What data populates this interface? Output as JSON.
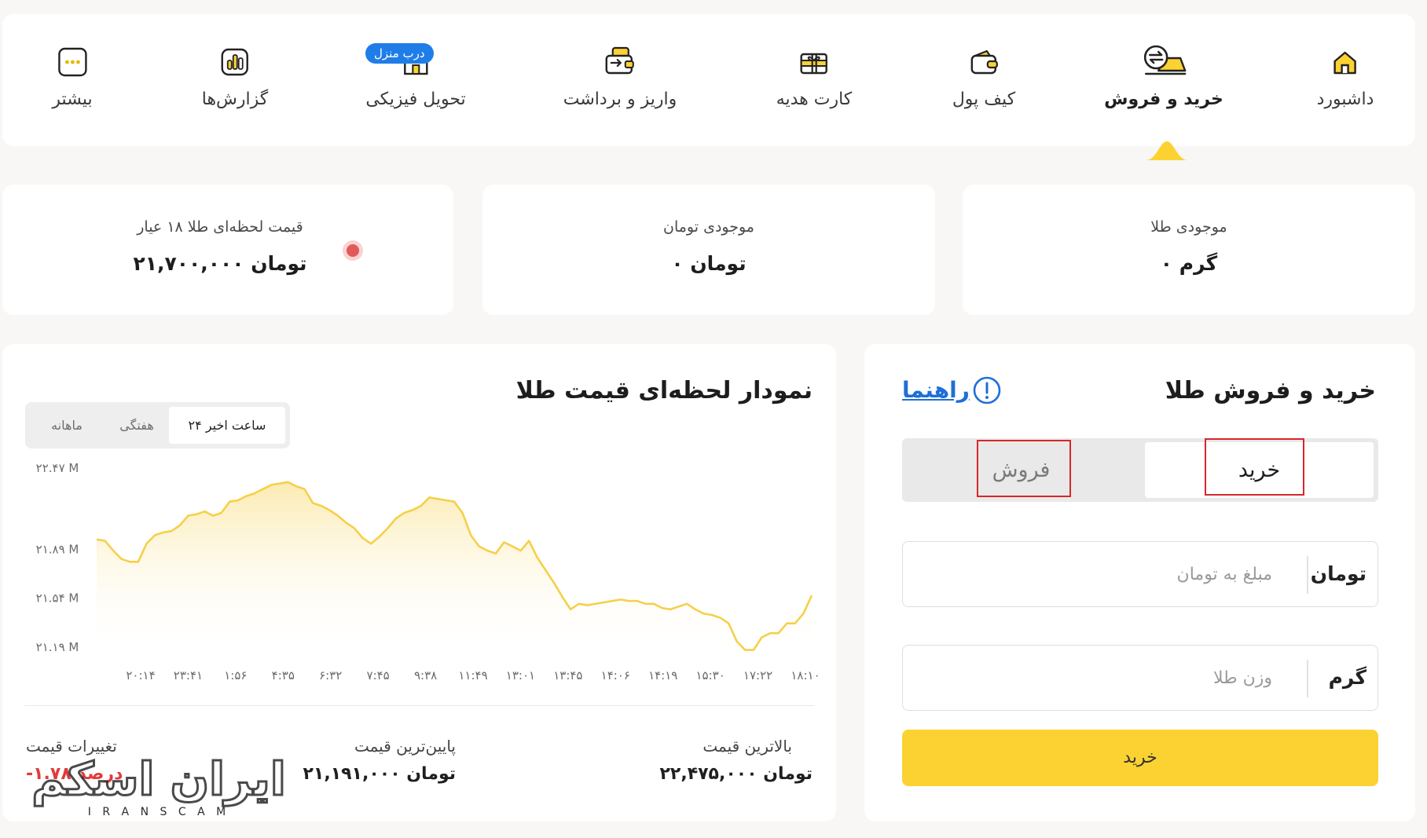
{
  "nav": {
    "items": [
      {
        "key": "dashboard",
        "label": "داشبورد",
        "icon": "home-icon"
      },
      {
        "key": "trade",
        "label": "خرید و فروش",
        "icon": "gold-exchange-icon",
        "active": true
      },
      {
        "key": "wallet",
        "label": "کیف پول",
        "icon": "wallet-icon"
      },
      {
        "key": "giftcard",
        "label": "کارت هدیه",
        "icon": "gift-card-icon"
      },
      {
        "key": "deposit",
        "label": "واریز و برداشت",
        "icon": "deposit-withdraw-icon"
      },
      {
        "key": "delivery",
        "label": "تحویل فیزیکی",
        "icon": "shop-icon",
        "badge": "درب منزل"
      },
      {
        "key": "reports",
        "label": "گزارش‌ها",
        "icon": "report-icon"
      },
      {
        "key": "more",
        "label": "بیشتر",
        "icon": "more-icon"
      }
    ]
  },
  "stats": {
    "gold_balance": {
      "title": "موجودی طلا",
      "value": "۰ گرم"
    },
    "toman_balance": {
      "title": "موجودی تومان",
      "value": "۰ تومان"
    },
    "live_price": {
      "title": "قیمت لحظه‌ای طلا ۱۸ عیار",
      "value": "۲۱,۷۰۰,۰۰۰ تومان"
    }
  },
  "chart": {
    "title": "نمودار لحظه‌ای قیمت طلا",
    "tabs": [
      "۲۴ ساعت اخیر",
      "هفتگی",
      "ماهانه"
    ],
    "active_tab": 0,
    "summary": {
      "max_label": "بالاترین قیمت",
      "max_value": "۲۲,۴۷۵,۰۰۰ تومان",
      "min_label": "پایین‌ترین قیمت",
      "min_value": "۲۱,۱۹۱,۰۰۰ تومان",
      "change_label": "تغییرات قیمت",
      "change_value": "-۱.۷۸ درصد"
    }
  },
  "chart_data": {
    "type": "area",
    "title": "نمودار لحظه‌ای قیمت طلا",
    "xlabel": "",
    "ylabel": "",
    "y_tick_labels": [
      "۲۲.۴۷ M",
      "۲۱.۸۹ M",
      "۲۱.۵۴ M",
      "۲۱.۱۹ M"
    ],
    "y_ticks": [
      22.47,
      21.89,
      21.54,
      21.19
    ],
    "x_tick_labels": [
      "۲۰:۱۴",
      "۲۳:۴۱",
      "۱:۵۶",
      "۴:۳۵",
      "۶:۳۲",
      "۷:۴۵",
      "۹:۳۸",
      "۱۱:۴۹",
      "۱۳:۰۱",
      "۱۳:۴۵",
      "۱۴:۰۶",
      "۱۴:۱۹",
      "۱۵:۳۰",
      "۱۷:۲۲",
      "۱۸:۱۰"
    ],
    "ylim": [
      21.19,
      22.47
    ],
    "series": [
      {
        "values": [
          21.96,
          21.95,
          21.88,
          21.82,
          21.8,
          21.8,
          21.93,
          21.99,
          22.01,
          22.02,
          22.06,
          22.13,
          22.14,
          22.16,
          22.13,
          22.15,
          22.23,
          22.24,
          22.27,
          22.29,
          22.32,
          22.35,
          22.36,
          22.37,
          22.34,
          22.32,
          22.22,
          22.2,
          22.17,
          22.13,
          22.08,
          22.04,
          21.97,
          21.93,
          21.98,
          22.04,
          22.11,
          22.15,
          22.17,
          22.2,
          22.26,
          22.25,
          22.24,
          22.23,
          22.15,
          21.99,
          21.91,
          21.88,
          21.86,
          21.94,
          21.91,
          21.88,
          21.95,
          21.83,
          21.74,
          21.65,
          21.55,
          21.46,
          21.5,
          21.49,
          21.5,
          21.51,
          21.52,
          21.53,
          21.52,
          21.52,
          21.5,
          21.5,
          21.47,
          21.46,
          21.48,
          21.5,
          21.46,
          21.43,
          21.42,
          21.4,
          21.36,
          21.23,
          21.17,
          21.17,
          21.26,
          21.29,
          21.29,
          21.36,
          21.36,
          21.43,
          21.56
        ],
        "color": "#f5d04a"
      }
    ],
    "grid": false,
    "legend": "none"
  },
  "trade": {
    "title": "خرید و فروش طلا",
    "guide_label": "راهنما",
    "buy_label": "خرید",
    "sell_label": "فروش",
    "amount_placeholder": "مبلغ به تومان",
    "amount_unit": "تومان",
    "weight_placeholder": "وزن طلا",
    "weight_unit": "گرم",
    "submit_label": "خرید"
  },
  "watermark": {
    "text": "ایران اسکم",
    "subtext": "I R A N   S C A M"
  },
  "colors": {
    "accent": "#fbd232",
    "link": "#1e6fd9",
    "badge": "#1f7de8",
    "negative": "#e03b3b"
  }
}
